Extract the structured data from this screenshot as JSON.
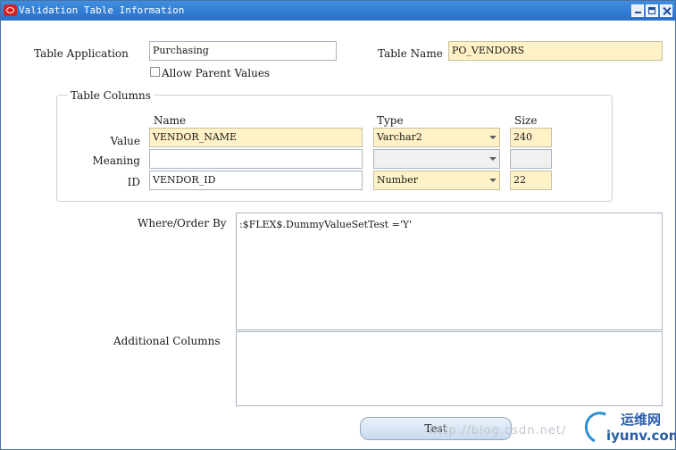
{
  "window": {
    "title": "Validation Table Information"
  },
  "table_application": {
    "label": "Table Application",
    "value": "Purchasing"
  },
  "table_name": {
    "label": "Table Name",
    "value": "PO_VENDORS"
  },
  "allow_parent_values": {
    "label": "Allow Parent Values",
    "checked": false
  },
  "table_columns": {
    "title": "Table Columns",
    "headers": {
      "name": "Name",
      "type": "Type",
      "size": "Size"
    },
    "rows": [
      {
        "label": "Value",
        "name": "VENDOR_NAME",
        "type": "Varchar2",
        "size": "240"
      },
      {
        "label": "Meaning",
        "name": "",
        "type": "",
        "size": ""
      },
      {
        "label": "ID",
        "name": "VENDOR_ID",
        "type": "Number",
        "size": "22"
      }
    ]
  },
  "where_order_by": {
    "label": "Where/Order By",
    "value": ":$FLEX$.DummyValueSetTest ='Y'"
  },
  "additional_columns": {
    "label": "Additional Columns",
    "value": ""
  },
  "buttons": {
    "test": "Test"
  },
  "watermark": {
    "url": "http://blog.csdn.net/",
    "logo_cn": "运维网",
    "logo_en": "iyunv.com"
  },
  "colors": {
    "titlebar": "#2a6fc9",
    "required_field": "#fff2c6",
    "field_border": "#a9b4c2"
  }
}
